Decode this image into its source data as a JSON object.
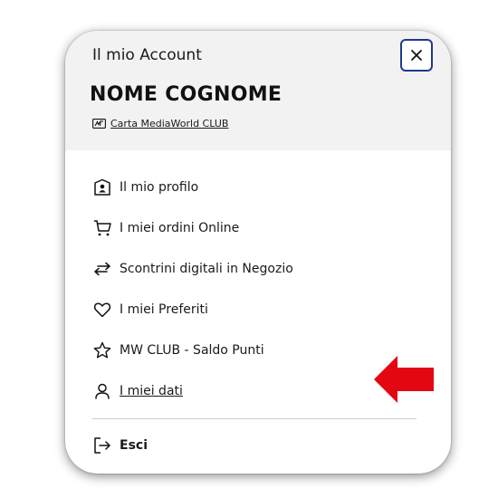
{
  "header": {
    "title": "Il mio Account",
    "user_name": "NOME COGNOME",
    "card_link": "Carta MediaWorld CLUB"
  },
  "menu": {
    "items": [
      {
        "label": "Il mio profilo",
        "icon": "profile-card-icon"
      },
      {
        "label": "I miei ordini Online",
        "icon": "cart-icon"
      },
      {
        "label": "Scontrini digitali in Negozio",
        "icon": "swap-arrows-icon"
      },
      {
        "label": "I miei Preferiti",
        "icon": "heart-icon"
      },
      {
        "label": "MW CLUB - Saldo Punti",
        "icon": "star-icon"
      },
      {
        "label": "I miei dati",
        "icon": "user-icon"
      }
    ],
    "logout_label": "Esci"
  },
  "colors": {
    "close_border": "#1e3a8a",
    "header_bg": "#f2f2f2",
    "arrow": "#e30613"
  }
}
